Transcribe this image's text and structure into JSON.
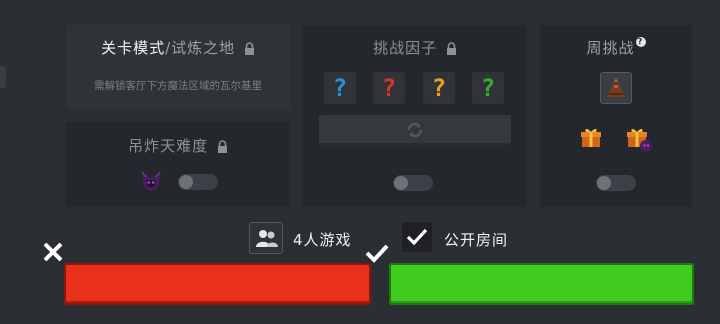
{
  "stage_mode": {
    "title_main": "关卡模式",
    "title_sep": "/",
    "title_alt": "试炼之地",
    "unlock_hint": "需解锁客厅下方魔法区域的瓦尔基里"
  },
  "difficulty": {
    "title": "吊炸天难度",
    "toggle_on": false
  },
  "challenge_factors": {
    "title": "挑战因子",
    "slots": [
      {
        "glyph": "?",
        "color": "#2b8fd8"
      },
      {
        "glyph": "?",
        "color": "#d6322e"
      },
      {
        "glyph": "?",
        "color": "#e6a21c"
      },
      {
        "glyph": "?",
        "color": "#3aab2c"
      }
    ],
    "toggle_on": false
  },
  "weekly_challenge": {
    "title": "周挑战",
    "help_glyph": "?",
    "toggle_on": false
  },
  "options": {
    "four_player_label": "4人游戏",
    "public_room_label": "公开房间",
    "public_room_checked": true
  },
  "buttons": {
    "cancel_color": "#e8301b",
    "confirm_color": "#3fcc1e"
  }
}
